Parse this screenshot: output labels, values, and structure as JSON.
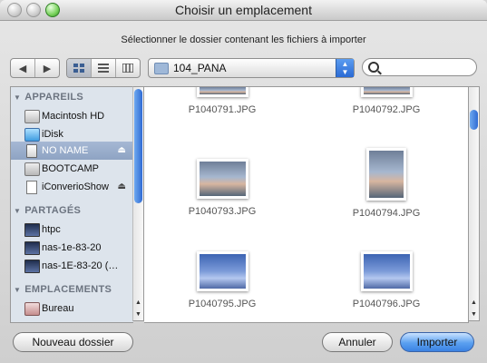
{
  "window": {
    "title": "Choisir un emplacement"
  },
  "prompt": "Sélectionner le dossier contenant les fichiers à importer",
  "toolbar": {
    "back_icon": "back-arrow-icon",
    "forward_icon": "forward-arrow-icon",
    "views": [
      "icon-view",
      "list-view",
      "column-view"
    ],
    "path_popup": {
      "selected": "104_PANA"
    },
    "search": {
      "value": "",
      "placeholder": ""
    }
  },
  "sidebar": {
    "sections": [
      {
        "title": "APPAREILS",
        "items": [
          {
            "label": "Macintosh HD",
            "icon": "hard-disk-icon"
          },
          {
            "label": "iDisk",
            "icon": "idisk-icon"
          },
          {
            "label": "NO NAME",
            "icon": "usb-drive-icon",
            "selected": true,
            "eject": "⏏"
          },
          {
            "label": "BOOTCAMP",
            "icon": "hard-disk-icon"
          },
          {
            "label": "iConverioShow",
            "icon": "document-icon",
            "eject": "⏏"
          }
        ]
      },
      {
        "title": "PARTAGÉS",
        "items": [
          {
            "label": "htpc",
            "icon": "monitor-icon"
          },
          {
            "label": "nas-1e-83-20",
            "icon": "monitor-icon"
          },
          {
            "label": "nas-1E-83-20 (…",
            "icon": "monitor-icon"
          }
        ]
      },
      {
        "title": "EMPLACEMENTS",
        "items": [
          {
            "label": "Bureau",
            "icon": "desktop-icon"
          }
        ]
      }
    ]
  },
  "files": [
    {
      "name": "P1040791.JPG"
    },
    {
      "name": "P1040792.JPG"
    },
    {
      "name": "P1040793.JPG"
    },
    {
      "name": "P1040794.JPG"
    },
    {
      "name": "P1040795.JPG"
    },
    {
      "name": "P1040796.JPG"
    }
  ],
  "buttons": {
    "new_folder": "Nouveau dossier",
    "cancel": "Annuler",
    "import": "Importer"
  }
}
